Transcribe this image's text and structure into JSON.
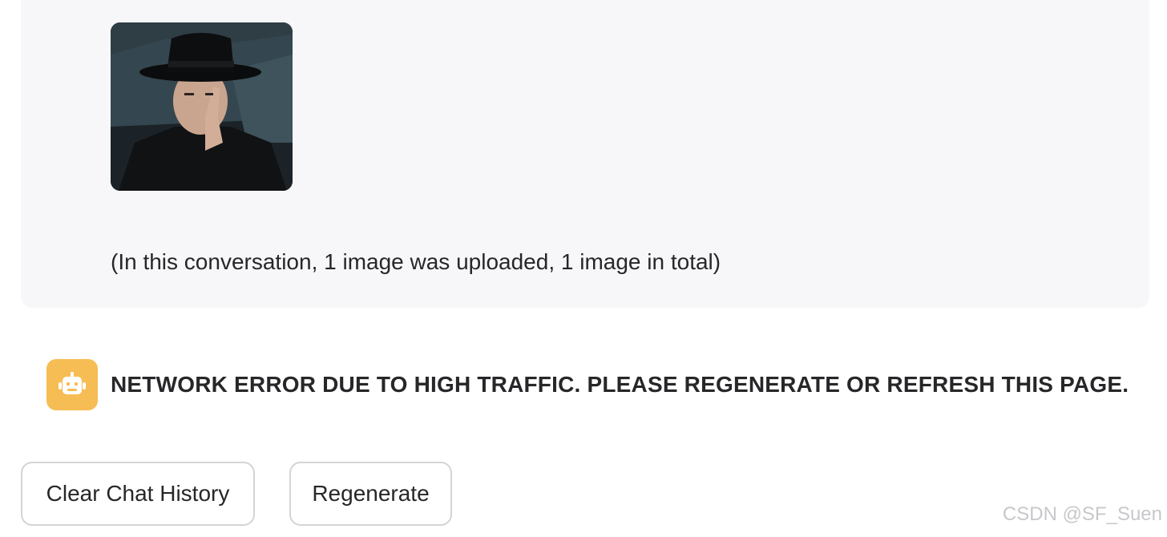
{
  "chat": {
    "user_message": {
      "image_alt": "",
      "upload_note": "(In this conversation, 1 image was uploaded, 1 image in total)"
    },
    "bot_message": {
      "avatar_icon": "robot-icon",
      "text": "NETWORK ERROR DUE TO HIGH TRAFFIC. PLEASE REGENERATE OR REFRESH THIS PAGE."
    }
  },
  "actions": {
    "clear_label": "Clear Chat History",
    "regenerate_label": "Regenerate"
  },
  "watermark": "CSDN @SF_Suen",
  "colors": {
    "card_background": "#f7f7f9",
    "avatar_background": "#f6bd55",
    "button_border": "#d4d4d8",
    "text": "#27272a"
  }
}
